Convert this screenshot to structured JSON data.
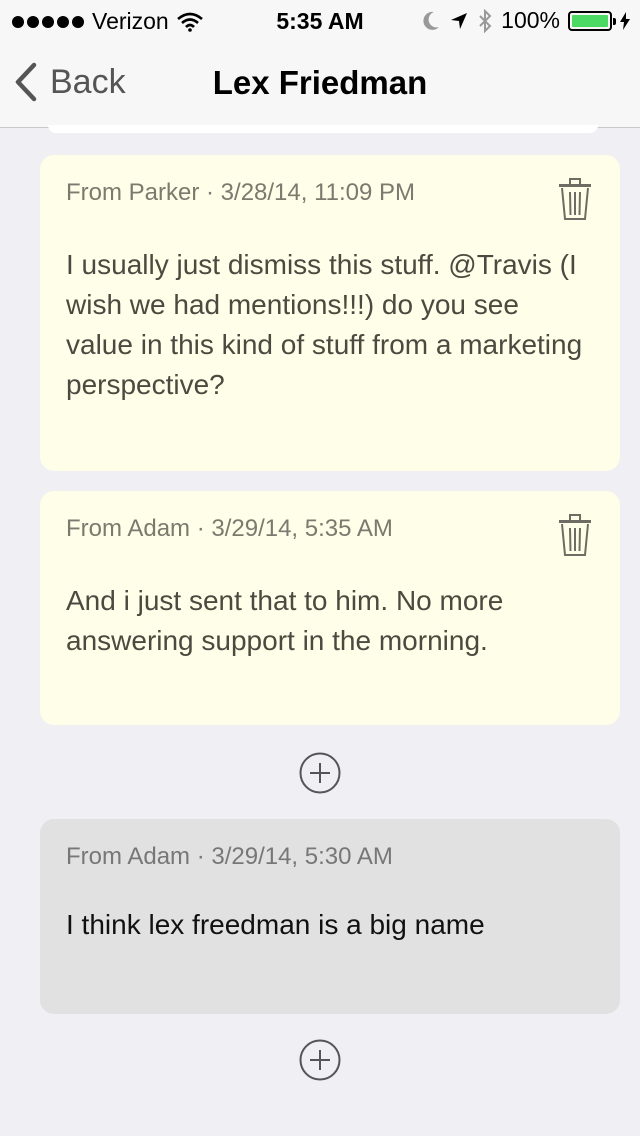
{
  "status_bar": {
    "carrier": "Verizon",
    "time": "5:35 AM",
    "battery_percent": "100%",
    "signal_bars": 5
  },
  "nav": {
    "back_label": "Back",
    "title": "Lex Friedman"
  },
  "notes": [
    {
      "meta": "From Parker · 3/28/14, 11:09 PM",
      "body": "I usually just dismiss this stuff. @Travis (I wish we had mentions!!!) do you see value in this kind of stuff from a marketing perspective?",
      "deletable": true,
      "style": "yellow"
    },
    {
      "meta": "From Adam · 3/29/14, 5:35 AM",
      "body": "And i just sent that to him. No more answering support in the morning.",
      "deletable": true,
      "style": "yellow"
    },
    {
      "meta": "From Adam · 3/29/14, 5:30 AM",
      "body": "I think lex freedman is a big name",
      "deletable": false,
      "style": "gray"
    }
  ],
  "colors": {
    "note_yellow": "#fefee9",
    "note_gray": "#e1e1e1",
    "background": "#efeff4",
    "battery_green": "#4cd964"
  },
  "icons": [
    "chevron-left-icon",
    "trash-icon",
    "plus-circle-icon",
    "wifi-icon",
    "moon-icon",
    "location-icon",
    "bluetooth-icon",
    "battery-icon"
  ]
}
